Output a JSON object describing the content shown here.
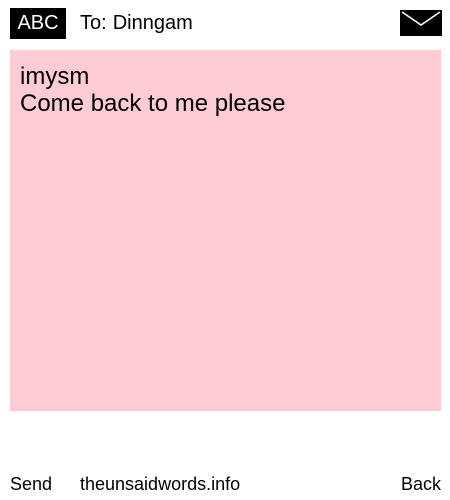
{
  "header": {
    "badge_label": "ABC",
    "to_prefix": "To:",
    "recipient": "Dinngam",
    "envelope_icon": "envelope-icon"
  },
  "message": {
    "lines": [
      "imysm",
      "Come back to me please"
    ],
    "background_color": "#ffccd6"
  },
  "footer": {
    "send_label": "Send",
    "site_label": "theunsaidwords.info",
    "back_label": "Back"
  }
}
